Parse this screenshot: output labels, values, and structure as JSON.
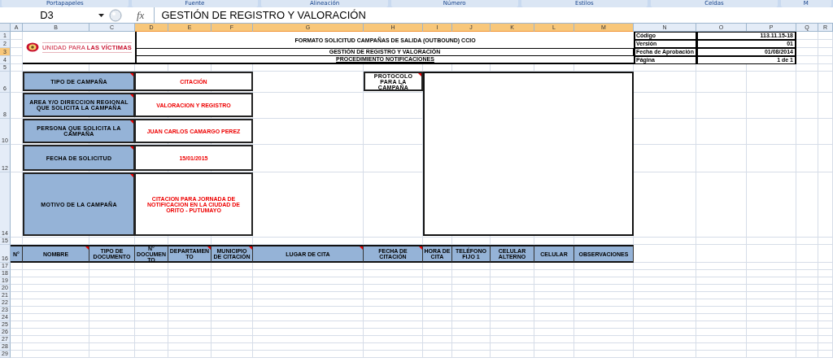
{
  "ribbon_groups": [
    "Portapapeles",
    "Fuente",
    "Alineación",
    "Número",
    "Estilos",
    "Celdas",
    "M"
  ],
  "formula_bar": {
    "cell": "D3",
    "fx": "fx",
    "value": "GESTIÓN DE REGISTRO Y VALORACIÓN"
  },
  "columns": [
    {
      "label": "A",
      "selected": false
    },
    {
      "label": "B",
      "selected": false
    },
    {
      "label": "C",
      "selected": false
    },
    {
      "label": "D",
      "selected": true
    },
    {
      "label": "E",
      "selected": true
    },
    {
      "label": "F",
      "selected": true
    },
    {
      "label": "G",
      "selected": true
    },
    {
      "label": "H",
      "selected": true
    },
    {
      "label": "I",
      "selected": true
    },
    {
      "label": "J",
      "selected": true
    },
    {
      "label": "K",
      "selected": true
    },
    {
      "label": "L",
      "selected": true
    },
    {
      "label": "M",
      "selected": true
    },
    {
      "label": "N",
      "selected": false
    },
    {
      "label": "O",
      "selected": false
    },
    {
      "label": "P",
      "selected": false
    },
    {
      "label": "Q",
      "selected": false
    },
    {
      "label": "R",
      "selected": false
    }
  ],
  "rows": [
    {
      "label": "1",
      "selected": false
    },
    {
      "label": "2",
      "selected": false
    },
    {
      "label": "3",
      "selected": true
    },
    {
      "label": "4",
      "selected": false
    },
    {
      "label": "5",
      "selected": false
    },
    {
      "label": "6",
      "selected": false
    },
    {
      "label": "8",
      "selected": false
    },
    {
      "label": "10",
      "selected": false
    },
    {
      "label": "12",
      "selected": false
    },
    {
      "label": "14",
      "selected": false
    },
    {
      "label": "15",
      "selected": false
    },
    {
      "label": "16",
      "selected": false
    },
    {
      "label": "17",
      "selected": false
    },
    {
      "label": "18",
      "selected": false
    },
    {
      "label": "19",
      "selected": false
    },
    {
      "label": "20",
      "selected": false
    },
    {
      "label": "21",
      "selected": false
    },
    {
      "label": "22",
      "selected": false
    },
    {
      "label": "23",
      "selected": false
    },
    {
      "label": "24",
      "selected": false
    },
    {
      "label": "25",
      "selected": false
    },
    {
      "label": "26",
      "selected": false
    },
    {
      "label": "27",
      "selected": false
    },
    {
      "label": "28",
      "selected": false
    },
    {
      "label": "29",
      "selected": false
    }
  ],
  "logo": {
    "text": "UNIDAD PARA **LAS VÍCTIMAS**"
  },
  "header": {
    "title": "FORMATO SOLICITUD CAMPAÑAS DE SALIDA (OUTBOUND) CCIO",
    "subtitle": "GESTIÓN DE REGISTRO Y VALORACIÓN",
    "procedure": "PROCEDIMIENTO NOTIFICACIONES"
  },
  "document_info": [
    {
      "label": "Código",
      "value": "113.11.15-18"
    },
    {
      "label": "Versión",
      "value": "01"
    },
    {
      "label": "Fecha de Aprobación",
      "value": "01/08/2014"
    },
    {
      "label": "Página",
      "value": "1 de 1"
    }
  ],
  "form_fields": [
    {
      "label": "TIPO DE CAMPAÑA",
      "value": "CITACIÓN",
      "commented": true
    },
    {
      "label": "AREA Y/O DIRECCION REGIONAL QUE SOLICITA LA CAMPAÑA",
      "value": "VALORACION Y REGISTRO",
      "commented": true
    },
    {
      "label": "PERSONA QUE SOLICITA LA CAMPAÑA",
      "value": "JUAN CARLOS CAMARGO PEREZ",
      "commented": true
    },
    {
      "label": "FECHA DE SOLICITUD",
      "value": "15/01/2015",
      "commented": true
    },
    {
      "label": "MOTIVO DE LA CAMPAÑA",
      "value": "CITACION PARA JORNADA DE NOTIFICACION EN LA CIUDAD DE ORITO - PUTUMAYO",
      "commented": true
    }
  ],
  "protocol": {
    "label": "PROTOCOLO  PARA LA CAMPAÑA",
    "commented": true
  },
  "table": {
    "columns": [
      {
        "label": "N°",
        "commented": false
      },
      {
        "label": "NOMBRE",
        "commented": true
      },
      {
        "label": "TIPO DE DOCUMENTO",
        "commented": false
      },
      {
        "label": "N° DOCUMENTO",
        "commented": false
      },
      {
        "label": "DEPARTAMENTO",
        "commented": true
      },
      {
        "label": "MUNICIPIO DE CITACIÓN",
        "commented": true
      },
      {
        "label": "LUGAR DE CITA",
        "commented": true
      },
      {
        "label": "FECHA DE CITACIÓN",
        "commented": true
      },
      {
        "label": "HORA DE CITA",
        "commented": false
      },
      {
        "label": "TELÉFONO FIJO 1",
        "commented": false
      },
      {
        "label": "CELULAR ALTERNO",
        "commented": false
      },
      {
        "label": "CELULAR",
        "commented": false
      },
      {
        "label": "OBSERVACIONES",
        "commented": false
      }
    ]
  }
}
